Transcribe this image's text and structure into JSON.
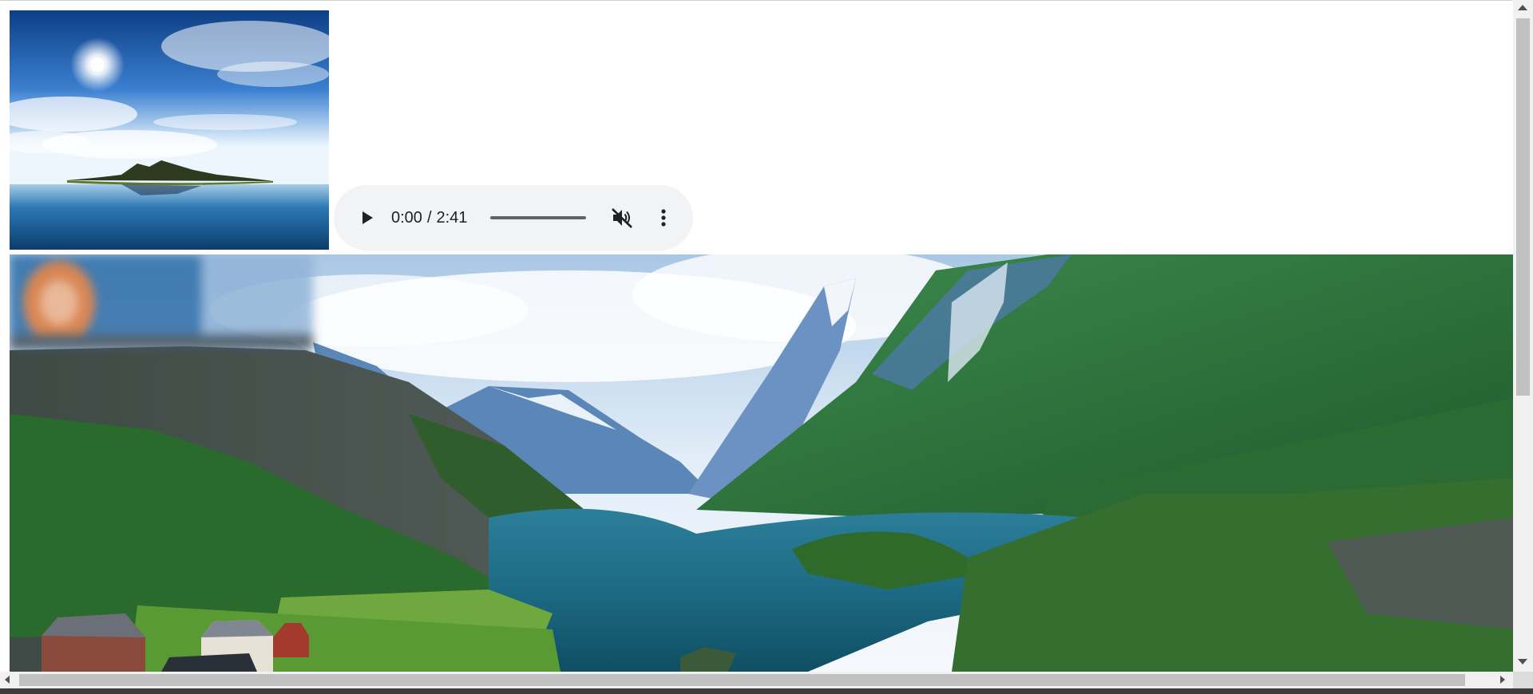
{
  "audio_player": {
    "current_time": "0:00",
    "time_separator": "/",
    "duration": "2:41",
    "progress": 0,
    "muted": true,
    "play_icon": "play-icon",
    "mute_icon": "volume-muted-icon",
    "menu_icon": "more-vertical-icon"
  },
  "colors": {
    "player_background": "#f1f3f4",
    "player_icon": "#202124",
    "scrollbar_track": "#f1f1f1",
    "scrollbar_thumb": "#c1c1c1"
  }
}
